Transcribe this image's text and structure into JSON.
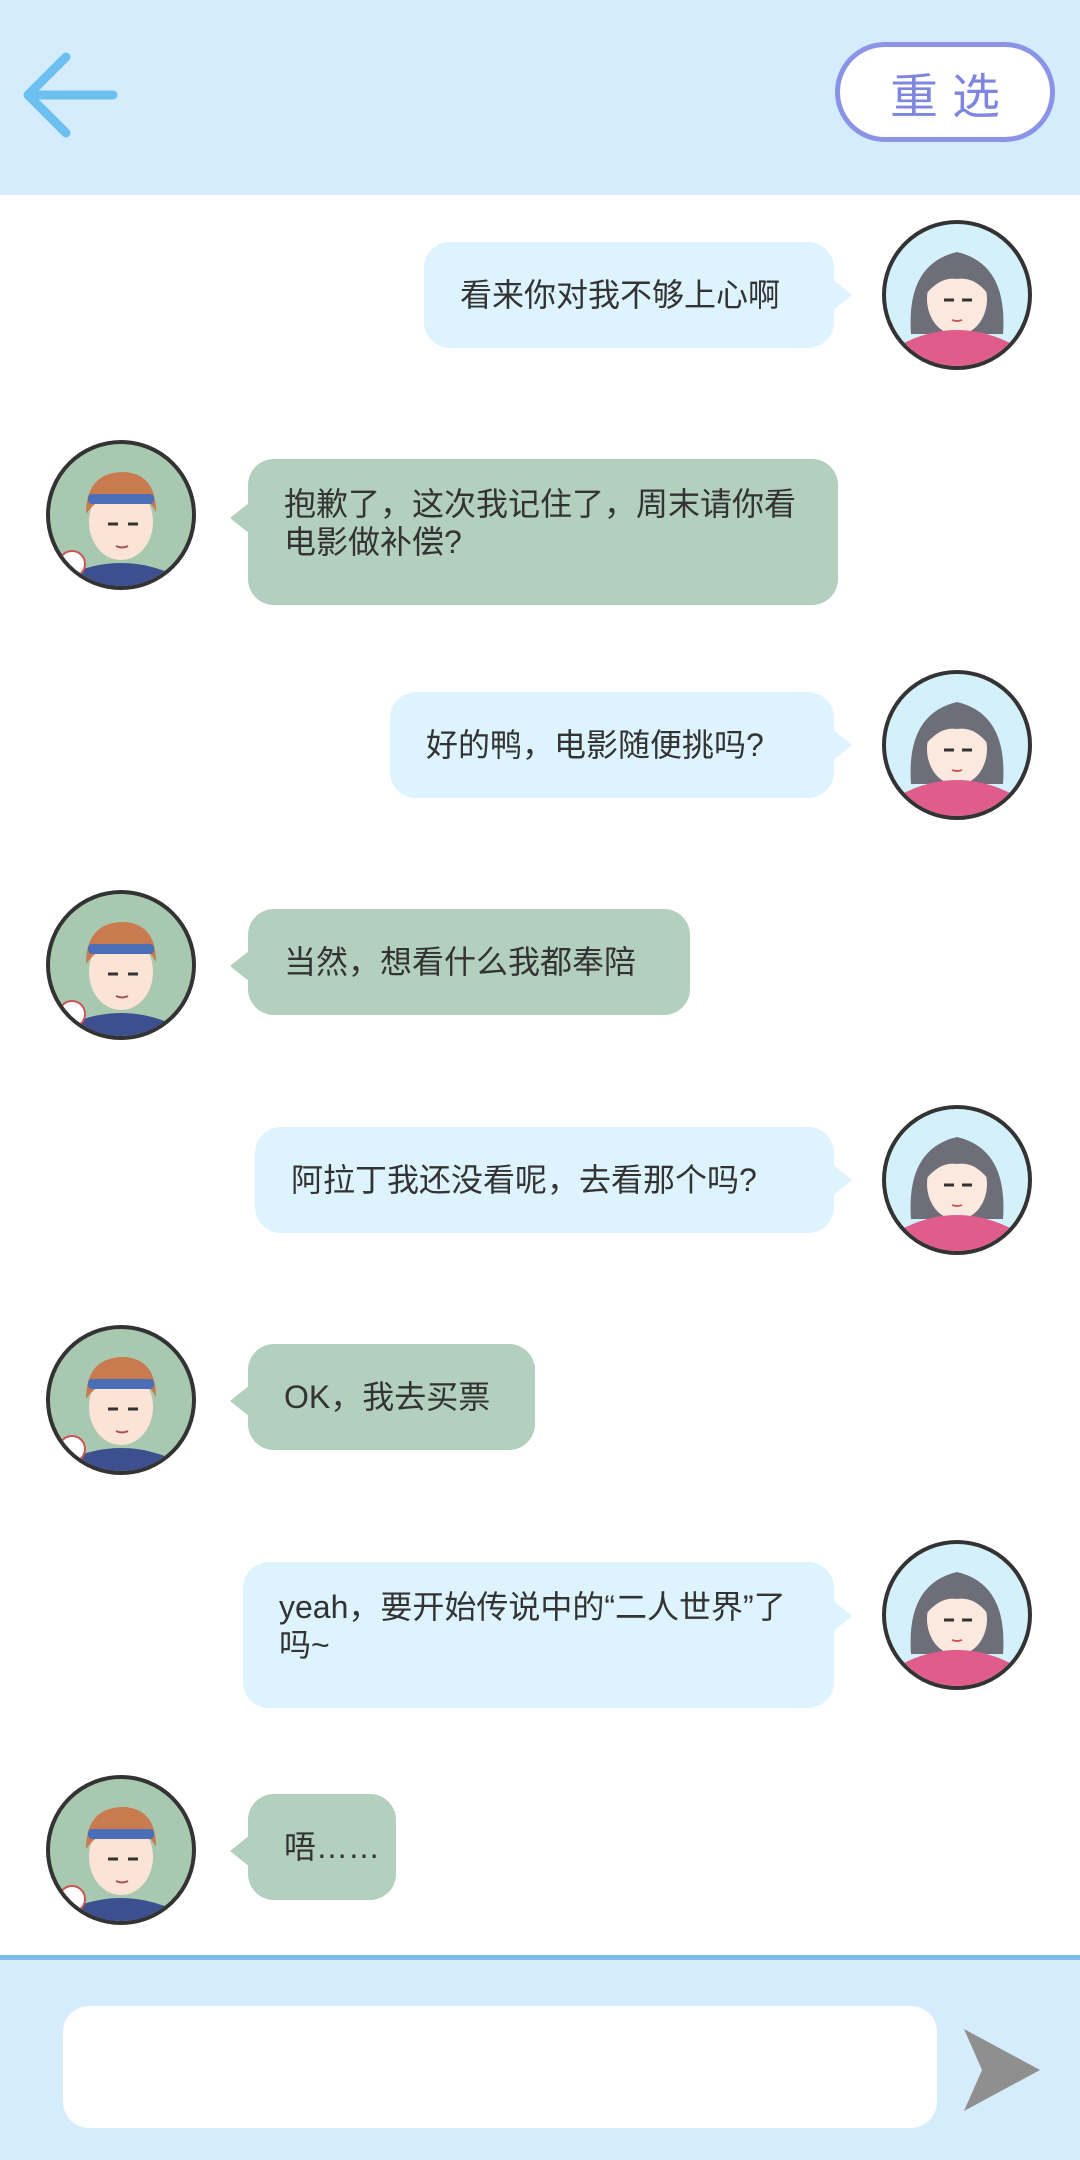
{
  "header": {
    "back_icon": "arrow-left-icon",
    "reselect_label": "重选",
    "colors": {
      "background": "#d5ecfc",
      "back_arrow": "#6cc0f0",
      "reselect": "#8a93e6"
    }
  },
  "messages": [
    {
      "sender": "girl",
      "text": "看来你对我不够上心啊"
    },
    {
      "sender": "boy",
      "text": "抱歉了，这次我记住了，周末请你看电影做补偿?"
    },
    {
      "sender": "girl",
      "text": "好的鸭，电影随便挑吗?"
    },
    {
      "sender": "boy",
      "text": "当然，想看什么我都奉陪"
    },
    {
      "sender": "girl",
      "text": "阿拉丁我还没看呢，去看那个吗?"
    },
    {
      "sender": "boy",
      "text": "OK，我去买票"
    },
    {
      "sender": "girl",
      "text": "yeah，要开始传说中的“二人世界”了吗~"
    },
    {
      "sender": "boy",
      "text": "唔……"
    }
  ],
  "composer": {
    "input_value": "",
    "input_placeholder": "",
    "send_icon": "send-arrow-icon",
    "colors": {
      "border": "#79bde8",
      "send": "#8f8f8f"
    }
  },
  "colors": {
    "girl_bubble": "#ddf3fd",
    "boy_bubble": "#b3cfbe",
    "text": "#333333"
  }
}
